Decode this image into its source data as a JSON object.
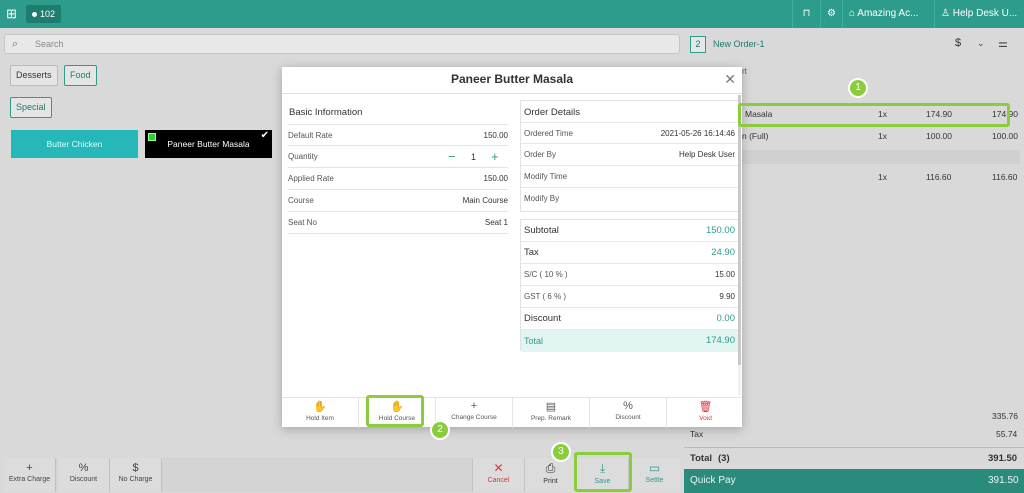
{
  "topbar": {
    "table_label": "102",
    "restaurant": "Amazing Ac...",
    "user": "Help Desk U..."
  },
  "search": {
    "placeholder": "Search"
  },
  "categories": [
    "Desserts",
    "Food"
  ],
  "subcategory": "Special",
  "menu_items": [
    "Butter Chicken",
    "Paneer Butter Masala"
  ],
  "left_toolbar": [
    {
      "icon": "+",
      "label": "Extra Charge"
    },
    {
      "icon": "%",
      "label": "Discount"
    },
    {
      "icon": "$",
      "label": "No Charge"
    }
  ],
  "order": {
    "number": "2",
    "name": "New Order-1",
    "currency_symbol": "$",
    "section_label": "rt",
    "items": [
      {
        "name": "Masala",
        "qty": "1x",
        "rate": "174.90",
        "amount": "174.90"
      },
      {
        "name": "n (Full)",
        "qty": "1x",
        "rate": "100.00",
        "amount": "100.00"
      },
      {
        "name": "",
        "qty": "1x",
        "rate": "116.60",
        "amount": "116.60"
      }
    ],
    "subtotal_value": "335.76",
    "tax_label": "Tax",
    "tax_value": "55.74",
    "total_label": "Total",
    "total_count": "(3)",
    "total_value": "391.50",
    "quickpay_label": "Quick Pay",
    "quickpay_value": "391.50"
  },
  "actions": [
    {
      "icon": "✕",
      "label": "Cancel",
      "color": "#d9363e"
    },
    {
      "icon": "⎙",
      "label": "Print",
      "color": "#444444"
    },
    {
      "icon": "⤓",
      "label": "Save",
      "color": "#2a9c8b"
    },
    {
      "icon": "▭",
      "label": "Settle",
      "color": "#2a9c8b"
    }
  ],
  "modal": {
    "title": "Paneer Butter Masala",
    "basic_info_title": "Basic Information",
    "default_rate_label": "Default Rate",
    "default_rate": "150.00",
    "quantity_label": "Quantity",
    "quantity": "1",
    "applied_rate_label": "Applied Rate",
    "applied_rate": "150.00",
    "course_label": "Course",
    "course": "Main Course",
    "seat_label": "Seat No",
    "seat": "Seat 1",
    "order_details_title": "Order Details",
    "ordered_time_label": "Ordered Time",
    "ordered_time": "2021-05-26 16:14:46",
    "order_by_label": "Order By",
    "order_by": "Help Desk User",
    "modify_time_label": "Modify Time",
    "modify_by_label": "Modify By",
    "subtotal_label": "Subtotal",
    "subtotal": "150.00",
    "tax_label": "Tax",
    "tax": "24.90",
    "sc_label": "S/C ( 10 % )",
    "sc": "15.00",
    "gst_label": "GST ( 6 % )",
    "gst": "9.90",
    "discount_label": "Discount",
    "discount": "0.00",
    "total_label": "Total",
    "total": "174.90",
    "footer": [
      {
        "icon": "✋",
        "label": "Hold Item"
      },
      {
        "icon": "✋",
        "label": "Hold Course"
      },
      {
        "icon": "+",
        "label": "Change Course"
      },
      {
        "icon": "▤",
        "label": "Prep. Remark"
      },
      {
        "icon": "%",
        "label": "Discount"
      },
      {
        "icon": "🗑",
        "label": "Void"
      }
    ]
  },
  "callouts": [
    "1",
    "2",
    "3"
  ],
  "colors": {
    "brand": "#2e9c8c",
    "highlight": "#8bcc3c",
    "danger": "#d9363e"
  }
}
